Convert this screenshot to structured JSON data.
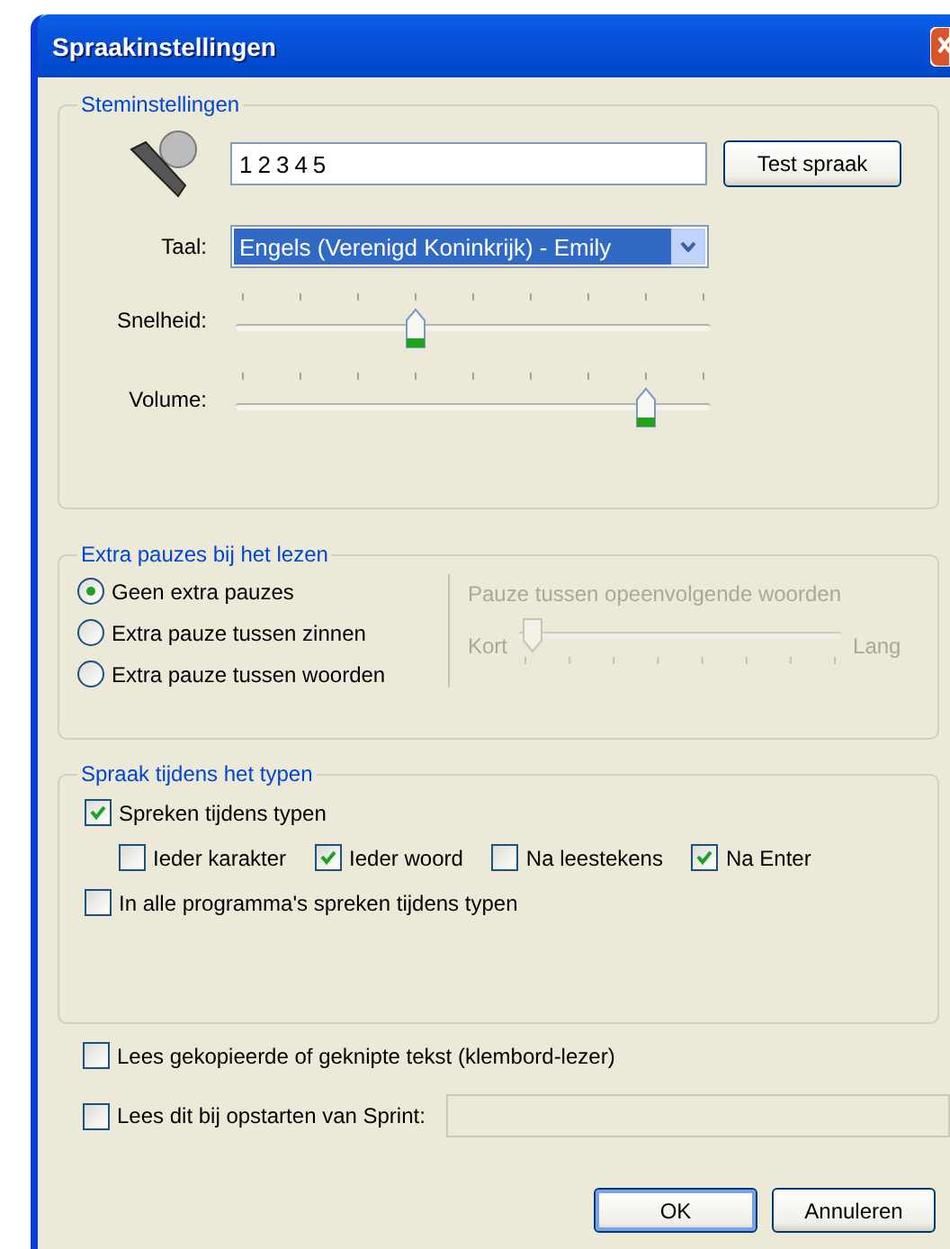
{
  "window": {
    "title": "Spraakinstellingen"
  },
  "voice": {
    "title": "Steminstellingen",
    "text_value": "12345",
    "test_button": "Test spraak",
    "language_label": "Taal:",
    "language_value": "Engels (Verenigd Koninkrijk) - Emily",
    "sliders": [
      {
        "label": "Snelheid:",
        "level": 0.375
      },
      {
        "label": "Volume:",
        "level": 0.875
      }
    ]
  },
  "pauses": {
    "title": "Extra pauzes bij het lezen",
    "options": [
      {
        "label": "Geen extra pauzes",
        "selected": true
      },
      {
        "label": "Extra pauze tussen zinnen",
        "selected": false
      },
      {
        "label": "Extra pauze tussen woorden",
        "selected": false
      }
    ],
    "pause_slider": {
      "title": "Pauze tussen opeenvolgende woorden",
      "min_label": "Kort",
      "max_label": "Lang",
      "level": 0,
      "disabled": true
    }
  },
  "typing": {
    "title": "Spraak tijdens het typen",
    "speak": {
      "label": "Spreken tijdens typen",
      "checked": true
    },
    "options": [
      {
        "label": "Ieder karakter",
        "checked": false
      },
      {
        "label": "Ieder woord",
        "checked": true
      },
      {
        "label": "Na leestekens",
        "checked": false
      },
      {
        "label": "Na Enter",
        "checked": true
      }
    ],
    "all_programs": {
      "label": "In alle programma's spreken tijdens typen",
      "checked": false
    }
  },
  "clipboard": {
    "label": "Lees gekopieerde of geknipte tekst (klembord-lezer)",
    "checked": false
  },
  "startup": {
    "label": "Lees dit bij opstarten van Sprint:",
    "checked": false
  },
  "buttons": [
    {
      "label": "OK",
      "default": true
    },
    {
      "label": "Annuleren",
      "default": false
    }
  ]
}
